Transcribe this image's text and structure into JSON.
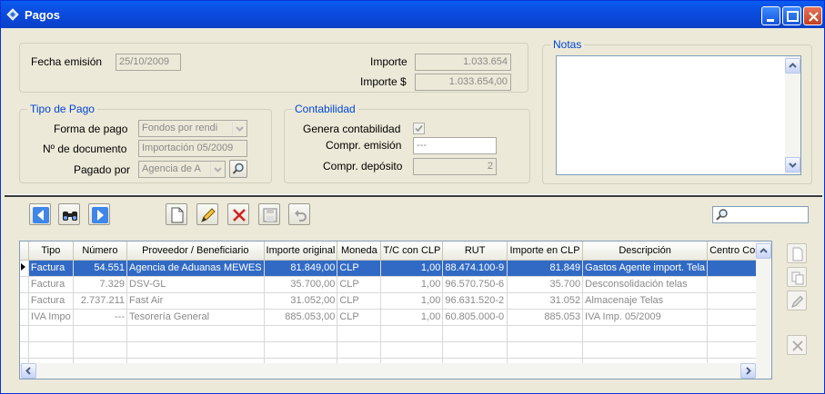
{
  "window": {
    "title": "Pagos"
  },
  "header": {
    "fecha_label": "Fecha emisión",
    "fecha_value": "25/10/2009",
    "importe_label": "Importe",
    "importe_value": "1.033.654",
    "importe_clp_label": "Importe $",
    "importe_clp_value": "1.033.654,00"
  },
  "notas": {
    "title": "Notas",
    "value": ""
  },
  "tipo_pago": {
    "title": "Tipo de Pago",
    "forma_label": "Forma de pago",
    "forma_value": "Fondos por rendi",
    "documento_label": "Nº de documento",
    "documento_value": "Importación 05/2009",
    "pagado_label": "Pagado por",
    "pagado_value": "Agencia de A"
  },
  "contabilidad": {
    "title": "Contabilidad",
    "genera_label": "Genera contabilidad",
    "genera_checked": true,
    "emision_label": "Compr. emisión",
    "emision_value": "---",
    "deposito_label": "Compr. depósito",
    "deposito_value": "2"
  },
  "toolbar": {
    "icons": [
      "prev-icon",
      "binoculars-icon",
      "next-icon",
      "new-icon",
      "edit-icon",
      "delete-icon",
      "save-icon",
      "undo-icon"
    ],
    "search_value": ""
  },
  "table": {
    "columns": [
      "Tipo",
      "Número",
      "Proveedor / Beneficiario",
      "Importe original",
      "Moneda",
      "T/C con CLP",
      "RUT",
      "Importe en CLP",
      "Descripción",
      "Centro Costo"
    ],
    "rows": [
      [
        "Factura",
        "54.551",
        "Agencia de Aduanas MEWES",
        "81.849,00",
        "CLP",
        "1,00",
        "88.474.100-9",
        "81.849",
        "Gastos Agente import. Tela",
        ""
      ],
      [
        "Factura",
        "7.329",
        "DSV-GL",
        "35.700,00",
        "CLP",
        "1,00",
        "96.570.750-6",
        "35.700",
        "Desconsolidación telas",
        ""
      ],
      [
        "Factura",
        "2.737.211",
        "Fast Air",
        "31.052,00",
        "CLP",
        "1,00",
        "96.631.520-2",
        "31.052",
        "Almacenaje Telas",
        ""
      ],
      [
        "IVA Impo",
        "---",
        "Tesorería General",
        "885.053,00",
        "CLP",
        "1,00",
        "60.805.000-0",
        "885.053",
        "IVA Imp. 05/2009",
        ""
      ],
      [
        "",
        "",
        "",
        "",
        "",
        "",
        "",
        "",
        "",
        ""
      ],
      [
        "",
        "",
        "",
        "",
        "",
        "",
        "",
        "",
        "",
        ""
      ],
      [
        "",
        "",
        "",
        "",
        "",
        "",
        "",
        "",
        "",
        ""
      ]
    ],
    "selected_row": 0
  },
  "colors": {
    "title_bar": "#0b4de0",
    "selection": "#316ac5",
    "group_title": "#0046d5"
  }
}
